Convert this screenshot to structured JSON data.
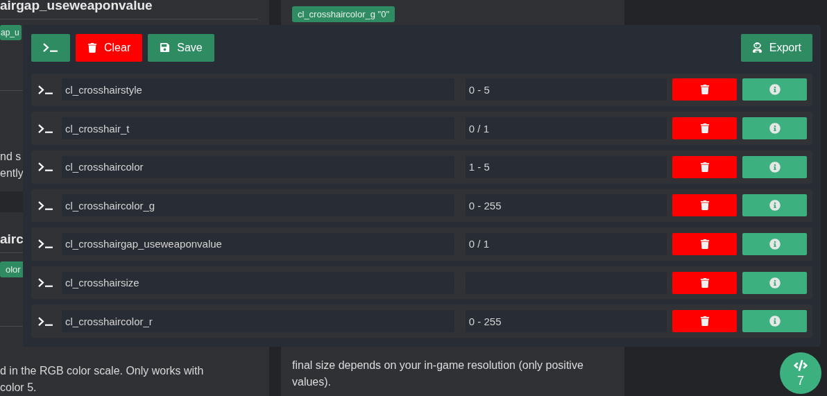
{
  "left_column": {
    "heading_top": "airgap_useweaponvalue",
    "tag_top": "ap_u",
    "text_top": [
      "nd s",
      "ently"
    ],
    "heading_mid": "airc",
    "tag_mid": "olor",
    "text_bottom": [
      "d in the RGB color scale. Only works with",
      "color 5."
    ]
  },
  "middle_column": {
    "tag": "cl_crosshaircolor_g \"0\"",
    "paragraph": "final size depends on your in-game resolution (only positive values)."
  },
  "modal": {
    "toolbar": [
      {
        "kind": "console"
      },
      {
        "kind": "clear",
        "label": "Clear"
      },
      {
        "kind": "save",
        "label": "Save"
      },
      {
        "kind": "export",
        "label": "Export"
      }
    ],
    "commands": [
      {
        "name": "cl_crosshairstyle",
        "range": "0 - 5"
      },
      {
        "name": "cl_crosshair_t",
        "range": "0 / 1"
      },
      {
        "name": "cl_crosshaircolor",
        "range": "1 - 5"
      },
      {
        "name": "cl_crosshaircolor_g",
        "range": "0 - 255"
      },
      {
        "name": "cl_crosshairgap_useweaponvalue",
        "range": "0 / 1"
      },
      {
        "name": "cl_crosshairsize"
      },
      {
        "name": "cl_crosshaircolor_r",
        "range": "0 - 255"
      }
    ]
  },
  "fab": {
    "count": "7"
  }
}
